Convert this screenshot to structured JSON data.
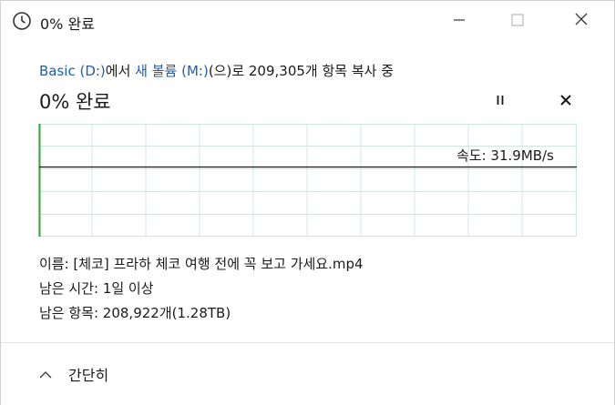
{
  "window": {
    "title": "0% 완료",
    "icons": {
      "title": "clock-icon",
      "minimize": "minimize-icon",
      "maximize": "maximize-icon",
      "close": "close-icon"
    }
  },
  "copy": {
    "source_name": "Basic (D:)",
    "from_suffix": "에서 ",
    "dest_name": "새 볼륨 (M:)",
    "to_suffix": "(으)로 209,305개 항목 복사 중",
    "heading": "0% 완료",
    "speed": "속도: 31.9MB/s",
    "name_line": "이름: [체코] 프라하 체코 여행 전에 꼭 보고 가세요.mp4",
    "time_line": "남은 시간: 1일 이상",
    "items_line": "남은 항목: 208,922개(1.28TB)",
    "progress_percent": 0
  },
  "controls": {
    "pause_icon": "pause-icon",
    "cancel_icon": "close-icon"
  },
  "footer": {
    "collapse_label": "간단히",
    "collapse_icon": "chevron-up-icon"
  },
  "colors": {
    "link": "#1f5fa8",
    "graph_grid": "#cfe8df",
    "graph_progress": "#3aa63a",
    "speed_line": "#1a1a1a"
  }
}
